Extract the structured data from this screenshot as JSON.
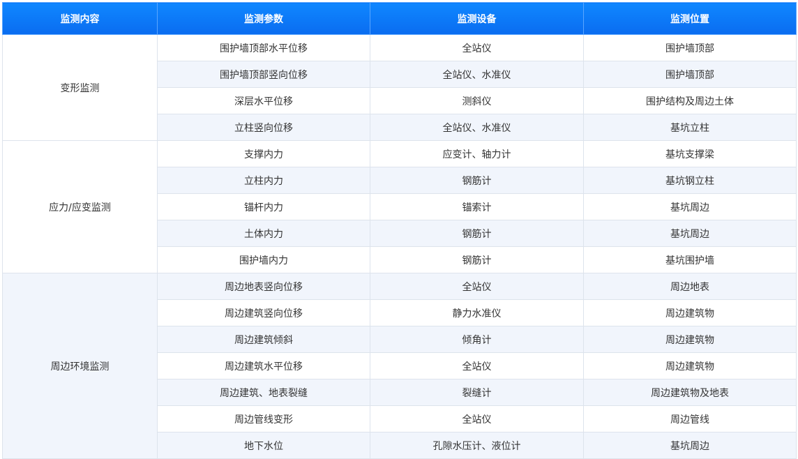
{
  "table": {
    "headers": [
      "监测内容",
      "监测参数",
      "监测设备",
      "监测位置"
    ],
    "groups": [
      {
        "name": "变形监测",
        "rows": [
          [
            "围护墙顶部水平位移",
            "全站仪",
            "围护墙顶部"
          ],
          [
            "围护墙顶部竖向位移",
            "全站仪、水准仪",
            "围护墙顶部"
          ],
          [
            "深层水平位移",
            "测斜仪",
            "围护结构及周边土体"
          ],
          [
            "立柱竖向位移",
            "全站仪、水准仪",
            "基坑立柱"
          ]
        ]
      },
      {
        "name": "应力/应变监测",
        "rows": [
          [
            "支撑内力",
            "应变计、轴力计",
            "基坑支撑梁"
          ],
          [
            "立柱内力",
            "钢筋计",
            "基坑钢立柱"
          ],
          [
            "锚杆内力",
            "锚索计",
            "基坑周边"
          ],
          [
            "土体内力",
            "钢筋计",
            "基坑周边"
          ],
          [
            "围护墙内力",
            "钢筋计",
            "基坑围护墙"
          ]
        ]
      },
      {
        "name": "周边环境监测",
        "rows": [
          [
            "周边地表竖向位移",
            "全站仪",
            "周边地表"
          ],
          [
            "周边建筑竖向位移",
            "静力水准仪",
            "周边建筑物"
          ],
          [
            "周边建筑倾斜",
            "倾角计",
            "周边建筑物"
          ],
          [
            "周边建筑水平位移",
            "全站仪",
            "周边建筑物"
          ],
          [
            "周边建筑、地表裂缝",
            "裂缝计",
            "周边建筑物及地表"
          ],
          [
            "周边管线变形",
            "全站仪",
            "周边管线"
          ],
          [
            "地下水位",
            "孔隙水压计、液位计",
            "基坑周边"
          ]
        ]
      }
    ]
  }
}
